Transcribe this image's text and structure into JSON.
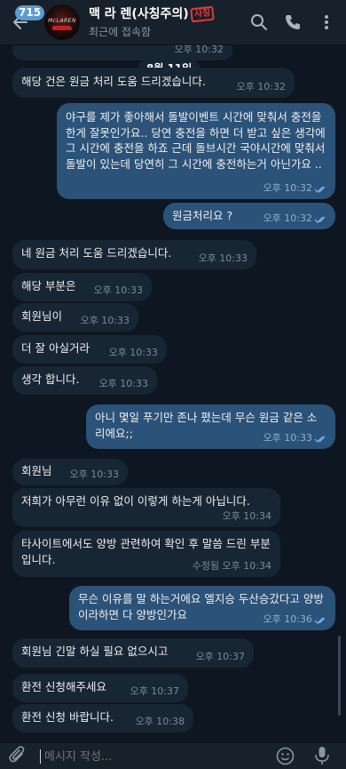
{
  "header": {
    "unread_badge": "715",
    "title": "맥 라 렌(사칭주의)",
    "title_badge": "사칭",
    "avatar_text": "McLAREN",
    "subtitle": "최근에 접속함"
  },
  "date_separator": "8월 11일",
  "messages": [
    {
      "dir": "in",
      "text": "",
      "time": "오후 10:32"
    },
    {
      "dir": "in",
      "text": "해당 건은 원금 처리 도움 드리겠습니다.",
      "time": "오후 10:32"
    },
    {
      "dir": "out",
      "text": "야구를 제가 좋아해서 돌발이벤트 시간에 맞춰서 충전을 한게 잘못인가요.. 당연 충전을 하면 더 받고 싶은 생각에 그 시간에 충전을 하죠 근데 돌브시간 국야시간에 맞춰서 돌발이 있는데 당연히 그 시간에 충전하는거 아닌가요 ..",
      "time": "오후 10:32"
    },
    {
      "dir": "out",
      "text": "원금처리요 ?",
      "time": "오후 10:32"
    },
    {
      "dir": "in",
      "text": "네 원금 처리 도움 드리겠습니다.",
      "time": "오후 10:33"
    },
    {
      "dir": "in",
      "text": "해당 부분은",
      "time": "오후 10:33"
    },
    {
      "dir": "in",
      "text": "회원님이",
      "time": "오후 10:33"
    },
    {
      "dir": "in",
      "text": "더 잘 아실거라",
      "time": "오후 10:33"
    },
    {
      "dir": "in",
      "text": "생각 합니다.",
      "time": "오후 10:33"
    },
    {
      "dir": "out",
      "text": "아니 몇일 푸기만 존나 폈는데 무슨 원금 같은 소리에요;;",
      "time": "오후 10:33"
    },
    {
      "dir": "in",
      "text": "회원님",
      "time": "오후 10:33"
    },
    {
      "dir": "in",
      "text": "저희가 아무런 이유 없이 이렇게 하는게 아닙니다.",
      "time": "오후 10:34"
    },
    {
      "dir": "in",
      "text": "타사이트에서도 양방 관련하여 확인 후 말씀 드린 부분 입니다.",
      "time": "수정됨 오후 10:34"
    },
    {
      "dir": "out",
      "text": "무슨 이유를 말 하는거에요 엘지승 두산승갔다고 양방이라하면 다 양방인가요",
      "time": "오후 10:36"
    },
    {
      "dir": "in",
      "text": "회원님 긴말 하실 필요 없으시고",
      "time": "오후 10:37"
    },
    {
      "dir": "in",
      "text": "환전 신청해주세요",
      "time": "오후 10:37"
    },
    {
      "dir": "in",
      "text": "환전 신청 바랍니다.",
      "time": "오후 10:38"
    }
  ],
  "composer": {
    "placeholder": "메시지 작성..."
  },
  "colors": {
    "background": "#0e1621",
    "incoming_bubble": "#182533",
    "outgoing_bubble": "#2b5278",
    "header": "#17212b",
    "accent": "#5b9bd1"
  }
}
